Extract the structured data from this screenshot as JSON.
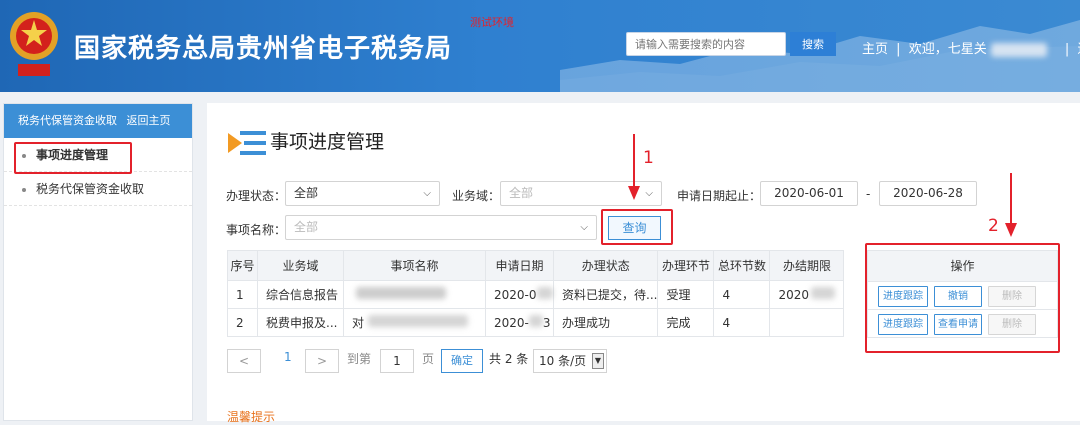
{
  "header": {
    "site_title": "国家税务总局贵州省电子税务局",
    "test_env": "测试环境",
    "search_placeholder": "请输入需要搜索的内容",
    "search_button": "搜索",
    "nav_home": "主页",
    "nav_welcome": "欢迎，七星关",
    "nav_logout": "退出",
    "separator": "|"
  },
  "sidebar": {
    "title": "税务代保管资金收取",
    "back_link": "返回主页",
    "items": [
      {
        "label": "事项进度管理",
        "active": true
      },
      {
        "label": "税务代保管资金收取",
        "active": false
      }
    ]
  },
  "page": {
    "title": "事项进度管理"
  },
  "filters": {
    "status_label": "办理状态：",
    "status_value": "全部",
    "domain_label": "业务域：",
    "domain_value": "全部",
    "date_label": "申请日期起止：",
    "date_from": "2020-06-01",
    "date_dash": "-",
    "date_to": "2020-06-28",
    "name_label": "事项名称：",
    "name_value": "全部",
    "query_button": "查询"
  },
  "annotations": {
    "marker_1": "1",
    "marker_2": "2"
  },
  "table": {
    "headers": [
      "序号",
      "业务域",
      "事项名称",
      "申请日期",
      "办理状态",
      "办理环节",
      "总环节数",
      "办结期限"
    ],
    "rows": [
      [
        "1",
        "综合信息报告",
        "",
        "2020-0",
        "资料已提交，待...",
        "受理",
        "4",
        "2020"
      ],
      [
        "2",
        "税费申报及...",
        "对",
        "2020-",
        "办理成功",
        "完成",
        "4",
        ""
      ]
    ],
    "row2_status_prefix": "3"
  },
  "operations": {
    "header": "操作",
    "rows": [
      [
        "进度跟踪",
        "撤销",
        "删除"
      ],
      [
        "进度跟踪",
        "查看申请",
        "删除"
      ]
    ]
  },
  "pager": {
    "prev": "<",
    "current": "1",
    "next": ">",
    "goto_label": "到第",
    "goto_value": "1",
    "page_unit": "页",
    "confirm": "确定",
    "total": "共 2 条",
    "page_size": "10 条/页"
  },
  "tip": "温馨提示",
  "colors": {
    "header_blue": "#2f80d0",
    "accent_blue": "#3c8fd6",
    "annotation_red": "#e3212b"
  }
}
